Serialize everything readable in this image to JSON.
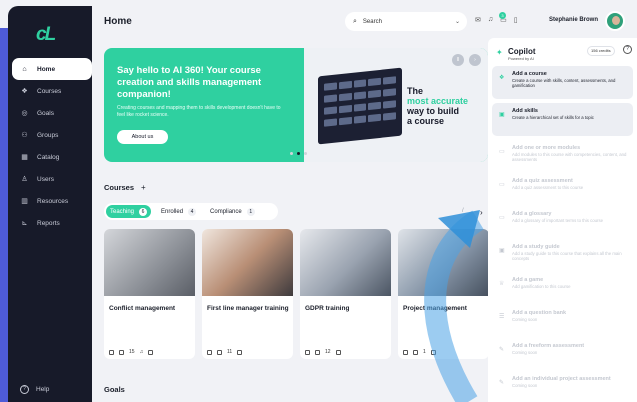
{
  "colors": {
    "accent": "#2fd0a0",
    "sidebar": "#171a29",
    "strip": "#4e5bd8"
  },
  "sidebar": {
    "logo": "cL",
    "items": [
      {
        "label": "Home",
        "icon": "home-icon",
        "glyph": "⌂"
      },
      {
        "label": "Courses",
        "icon": "courses-icon",
        "glyph": "❖"
      },
      {
        "label": "Goals",
        "icon": "goals-icon",
        "glyph": "◎"
      },
      {
        "label": "Groups",
        "icon": "groups-icon",
        "glyph": "⚇"
      },
      {
        "label": "Catalog",
        "icon": "catalog-icon",
        "glyph": "▦"
      },
      {
        "label": "Users",
        "icon": "users-icon",
        "glyph": "♙"
      },
      {
        "label": "Resources",
        "icon": "resources-icon",
        "glyph": "▥"
      },
      {
        "label": "Reports",
        "icon": "reports-icon",
        "glyph": "⊾"
      }
    ],
    "help": "Help"
  },
  "header": {
    "title": "Home",
    "search_label": "Search",
    "notifications_count": "3",
    "username": "Stephanie Brown"
  },
  "banner": {
    "headline": "Say hello to AI 360! Your course creation and skills management companion!",
    "body": "Creating courses and mapping them to skills development doesn't have to feel like rocket science.",
    "button": "About us",
    "caption_1": "The",
    "caption_2": "most accurate",
    "caption_3": "way to build",
    "caption_4": "a course"
  },
  "courses": {
    "title": "Courses",
    "tabs": [
      {
        "label": "Teaching",
        "count": "6"
      },
      {
        "label": "Enrolled",
        "count": "4"
      },
      {
        "label": "Compliance",
        "count": "1"
      }
    ],
    "cards": [
      {
        "title": "Conflict management",
        "count": "15"
      },
      {
        "title": "First line manager training",
        "count": "11"
      },
      {
        "title": "GDPR training",
        "count": "12"
      },
      {
        "title": "Project management",
        "count": "1"
      }
    ]
  },
  "goals": {
    "title": "Goals"
  },
  "copilot": {
    "title": "Copilot",
    "subtitle": "Powered by AI",
    "credits": "156 credits",
    "items": [
      {
        "title": "Add a course",
        "desc": "Create a course with skills, content, assessments, and gamification"
      },
      {
        "title": "Add skills",
        "desc": "Create a hierarchical set of skills for a topic"
      },
      {
        "title": "Add one or more modules",
        "desc": "Add modules to this course with competencies, content, and assessments"
      },
      {
        "title": "Add a quiz assessment",
        "desc": "Add a quiz assessment to this course"
      },
      {
        "title": "Add a glossary",
        "desc": "Add a glossary of important terms to this course"
      },
      {
        "title": "Add a study guide",
        "desc": "Add a study guide to this course that explains all the main concepts"
      },
      {
        "title": "Add a game",
        "desc": "Add gamification to this course"
      },
      {
        "title": "Add a question bank",
        "desc": "Coming soon"
      },
      {
        "title": "Add a freeform assessment",
        "desc": "Coming soon"
      },
      {
        "title": "Add an individual project assessment",
        "desc": "Coming soon"
      }
    ]
  }
}
